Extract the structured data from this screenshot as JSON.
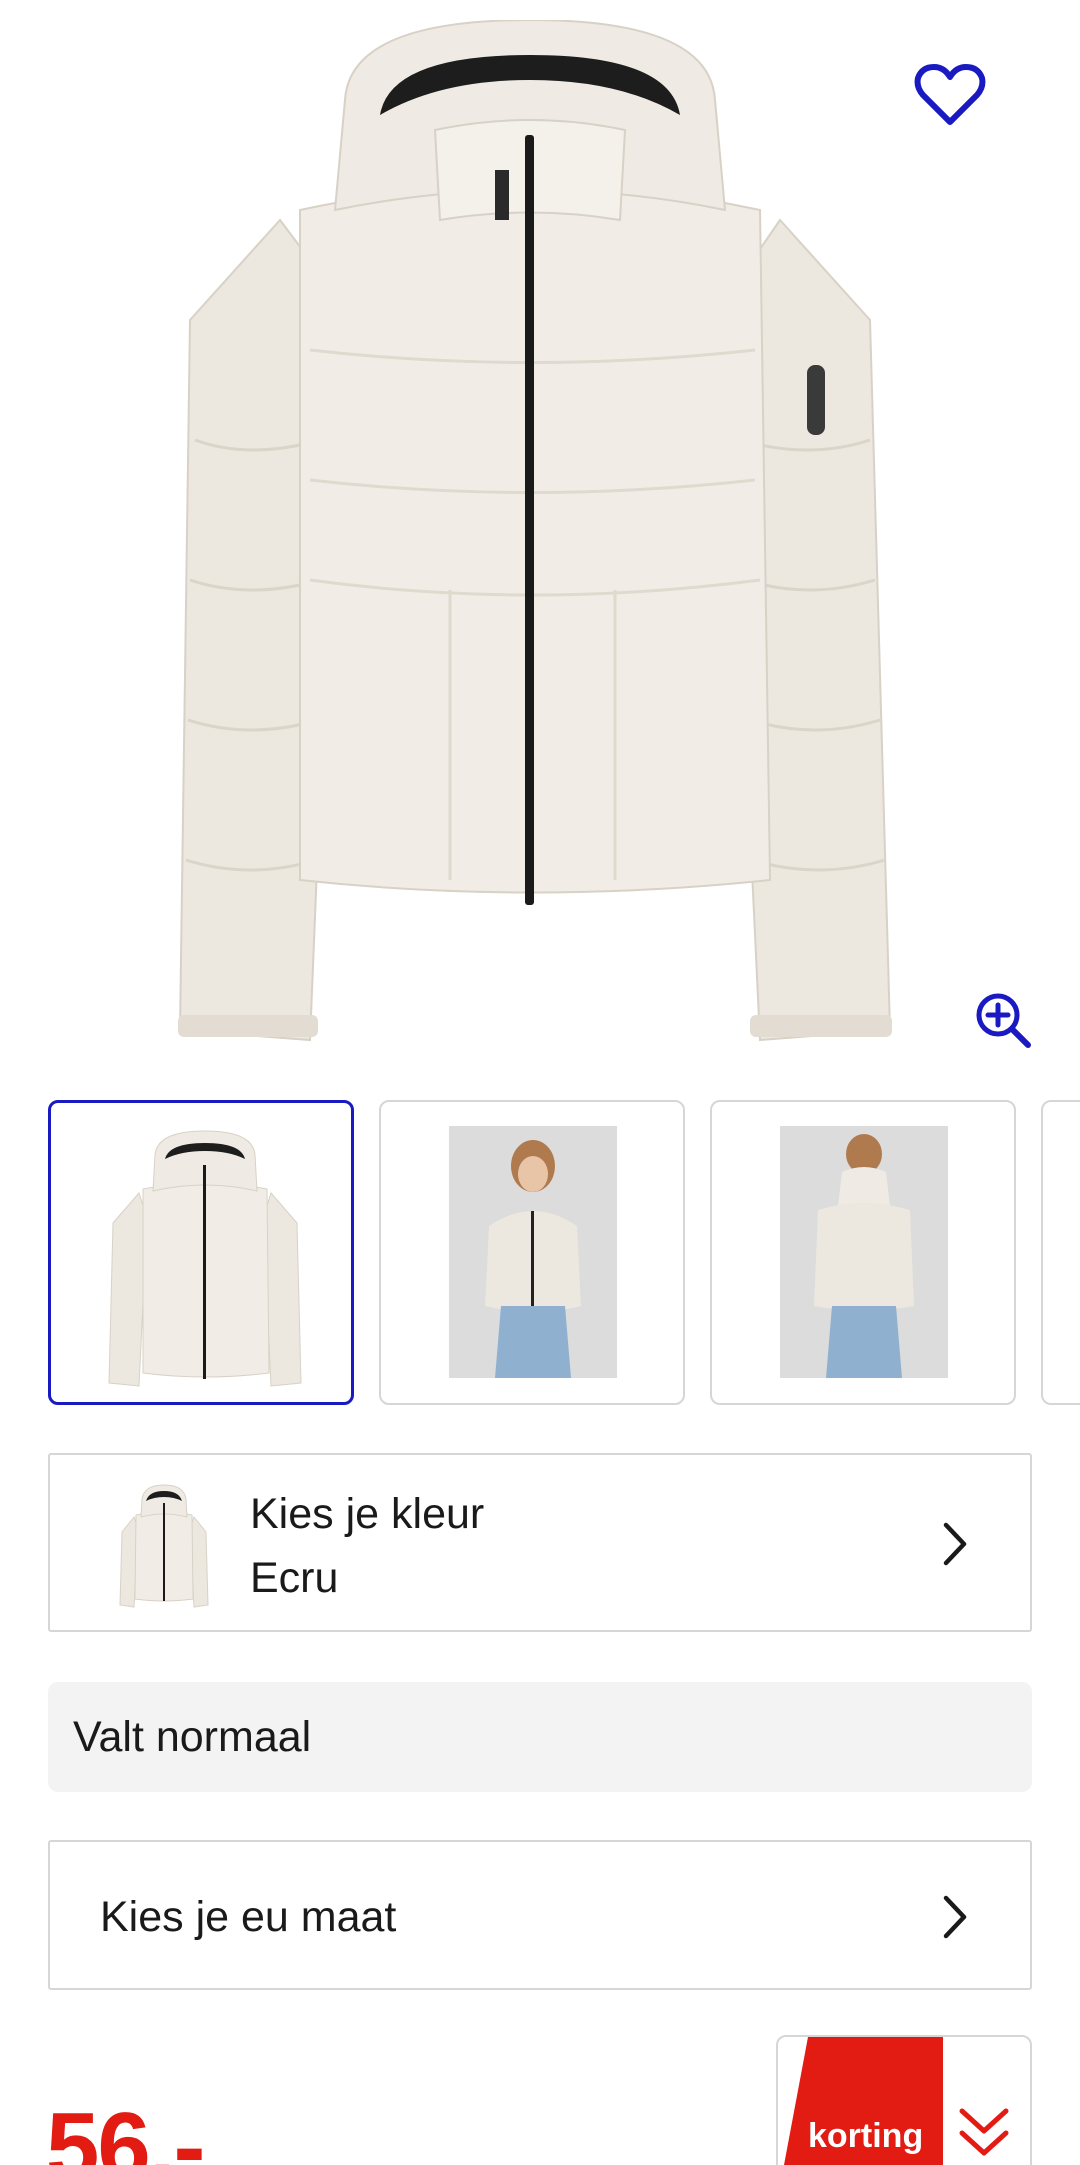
{
  "product": {
    "favorite_icon": "heart-icon",
    "zoom_icon": "zoom-in-icon"
  },
  "thumbnails": [
    {
      "name": "thumbnail-front",
      "selected": true
    },
    {
      "name": "thumbnail-model-front",
      "selected": false
    },
    {
      "name": "thumbnail-model-back",
      "selected": false
    }
  ],
  "color_selector": {
    "label": "Kies je kleur",
    "value": "Ecru"
  },
  "fit_info": {
    "label": "Valt normaal"
  },
  "size_selector": {
    "label": "Kies je eu maat"
  },
  "pricing": {
    "price": "56,-",
    "badge_label": "korting"
  },
  "colors": {
    "accent_blue": "#1a1ac2",
    "sale_red": "#e21b13",
    "border": "#d6d6d6",
    "fit_bg": "#f3f3f3"
  }
}
